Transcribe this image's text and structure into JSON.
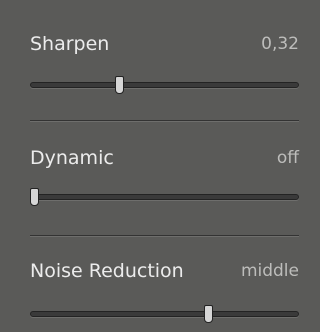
{
  "panel": {
    "items": [
      {
        "label": "Sharpen",
        "value": "0,32",
        "level": 0.33
      },
      {
        "label": "Dynamic",
        "value": "off",
        "level": 0.0
      },
      {
        "label": "Noise Reduction",
        "value": "middle",
        "level": 0.66
      }
    ]
  },
  "colors": {
    "background": "#5a5a58",
    "label": "#ececec",
    "value": "#bdbdbb",
    "track": "#3a3a3a",
    "thumb": "#d6d6d6"
  }
}
